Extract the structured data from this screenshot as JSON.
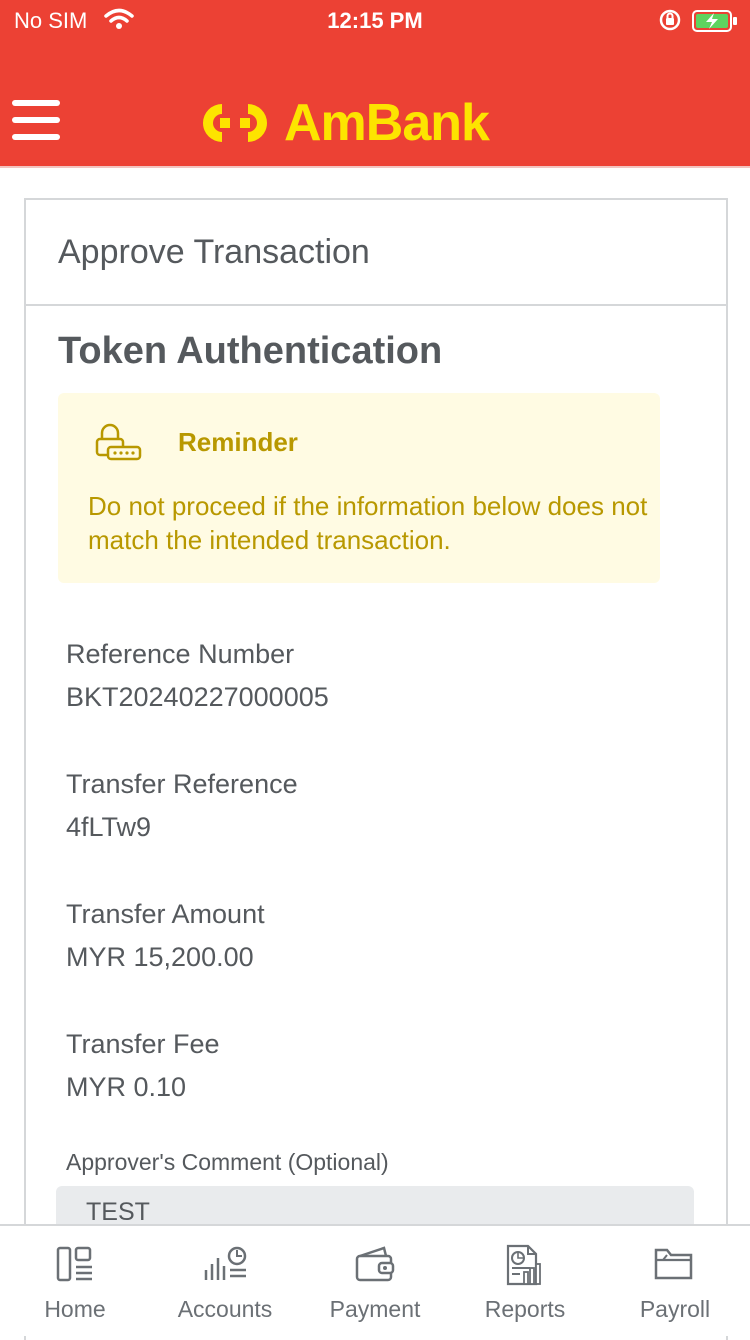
{
  "status_bar": {
    "carrier": "No SIM",
    "time": "12:15 PM"
  },
  "header": {
    "brand": "AmBank",
    "brand_color": "#fde400",
    "bar_color": "#ec4134"
  },
  "card": {
    "title": "Approve Transaction",
    "section_title": "Token Authentication",
    "reminder": {
      "icon": "lock-token-icon",
      "title": "Reminder",
      "text": "Do not proceed if the information below does not match the intended transaction."
    },
    "fields": [
      {
        "label": "Reference Number",
        "value": "BKT20240227000005"
      },
      {
        "label": "Transfer Reference",
        "value": "4fLTw9"
      },
      {
        "label": "Transfer Amount",
        "value": "MYR 15,200.00"
      },
      {
        "label": "Transfer Fee",
        "value": "MYR 0.10"
      }
    ],
    "comment": {
      "label": "Approver's Comment (Optional)",
      "value": "TEST"
    }
  },
  "bottom_nav": [
    {
      "label": "Home",
      "icon": "home-icon"
    },
    {
      "label": "Accounts",
      "icon": "accounts-icon"
    },
    {
      "label": "Payment",
      "icon": "wallet-icon"
    },
    {
      "label": "Reports",
      "icon": "reports-icon"
    },
    {
      "label": "Payroll",
      "icon": "folder-icon"
    }
  ]
}
